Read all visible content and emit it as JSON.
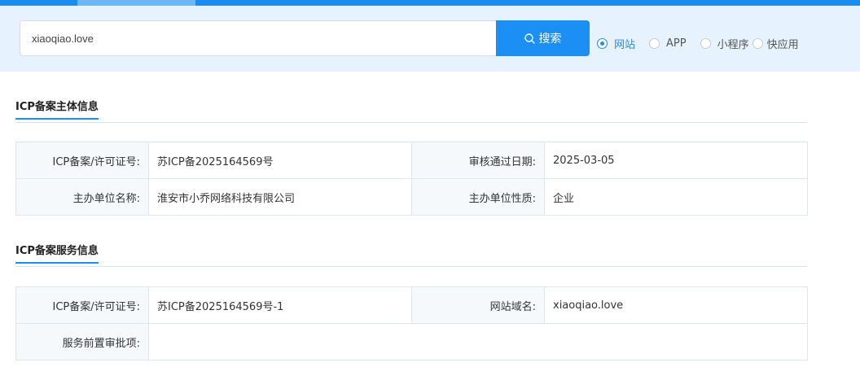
{
  "search": {
    "value": "xiaoqiao.love",
    "button_label": "搜索"
  },
  "radio_options": [
    {
      "label": "网站",
      "checked": true
    },
    {
      "label": "APP",
      "checked": false
    },
    {
      "label": "小程序",
      "checked": false
    },
    {
      "label": "快应用",
      "checked": false
    }
  ],
  "colors": {
    "accent": "#1b8ff3",
    "band": "#e6f2fd",
    "label_cell": "#f5f9fc"
  },
  "subject_section": {
    "title": "ICP备案主体信息",
    "rows": [
      {
        "k1": "ICP备案/许可证号:",
        "v1": "苏ICP备2025164569号",
        "k2": "审核通过日期:",
        "v2": "2025-03-05"
      },
      {
        "k1": "主办单位名称:",
        "v1": "淮安市小乔网络科技有限公司",
        "k2": "主办单位性质:",
        "v2": "企业"
      }
    ]
  },
  "service_section": {
    "title": "ICP备案服务信息",
    "rows": [
      {
        "k1": "ICP备案/许可证号:",
        "v1": "苏ICP备2025164569号-1",
        "k2": "网站域名:",
        "v2": "xiaoqiao.love"
      },
      {
        "k1": "服务前置审批项:",
        "v1": ""
      }
    ]
  }
}
